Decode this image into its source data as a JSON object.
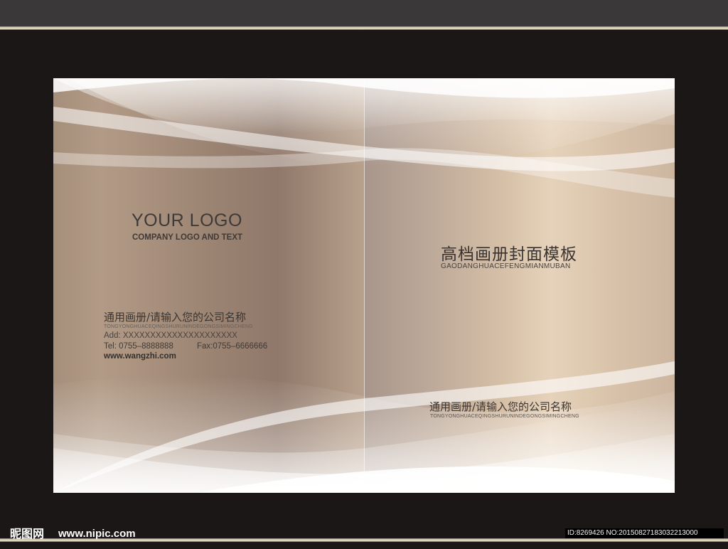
{
  "left_panel": {
    "logo_title": "YOUR LOGO",
    "logo_subtitle": "COMPANY LOGO AND TEXT",
    "company_name": "通用画册/请输入您的公司名称",
    "company_pinyin": "TONGYONGHUACEQINGSHURUNINDEGONGSIMINGCHENG",
    "address": "Add: XXXXXXXXXXXXXXXXXXXXX",
    "tel": "Tel: 0755–8888888",
    "fax": "Fax:0755–6666666",
    "website": "www.wangzhi.com"
  },
  "right_panel": {
    "title": "高档画册封面模板",
    "title_pinyin": "GAODANGHUACEFENGMIANMUBAN",
    "company_name": "通用画册/请输入您的公司名称",
    "company_pinyin": "TONGYONGHUACEQINGSHURUNINDEGONGSIMINGCHENG"
  },
  "watermark": {
    "logo_text": "昵图网",
    "site": "www.nipic.com",
    "id_text": "ID:8269426 NO:20150827183032213000"
  },
  "colors": {
    "background": "#1b1716",
    "top_strip": "#3a3838",
    "gold_line": "#efe7cf",
    "text_dark": "#3b3532"
  }
}
